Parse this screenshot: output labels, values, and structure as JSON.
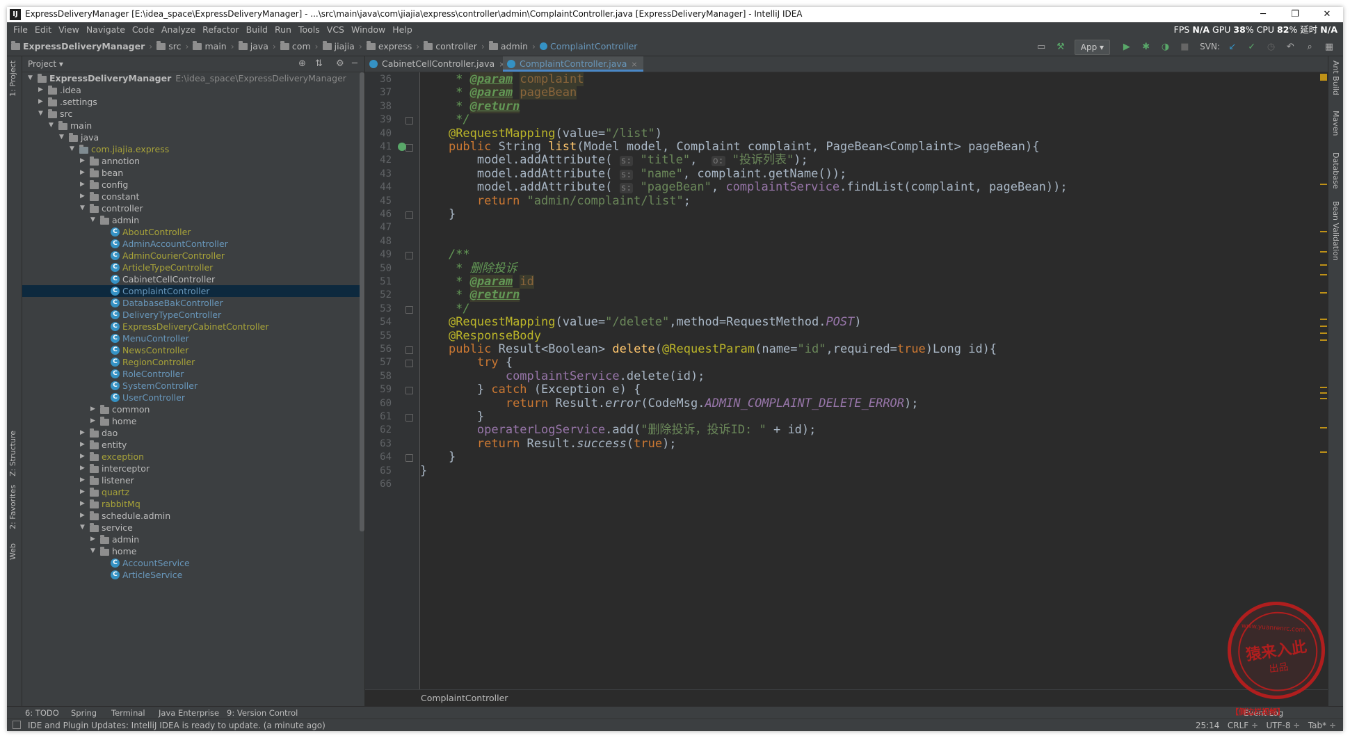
{
  "window": {
    "title": "ExpressDeliveryManager [E:\\idea_space\\ExpressDeliveryManager] - ...\\src\\main\\java\\com\\jiajia\\express\\controller\\admin\\ComplaintController.java [ExpressDeliveryManager] - IntelliJ IDEA",
    "app_icon": "IJ",
    "minimize": "─",
    "restore": "❐",
    "close": "✕"
  },
  "menu": [
    "File",
    "Edit",
    "View",
    "Navigate",
    "Code",
    "Analyze",
    "Refactor",
    "Build",
    "Run",
    "Tools",
    "VCS",
    "Window",
    "Help"
  ],
  "perf": {
    "fps_label": "FPS",
    "fps": "N/A",
    "gpu_label": "GPU",
    "gpu": "38",
    "cpu_label": "% CPU",
    "cpu": "82",
    "delay_label": "% 延时",
    "delay": "N/A"
  },
  "breadcrumbs": [
    "ExpressDeliveryManager",
    "src",
    "main",
    "java",
    "com",
    "jiajia",
    "express",
    "controller",
    "admin",
    "ComplaintController"
  ],
  "toolbar": {
    "run_config": "App ▾",
    "svn_label": "SVN:"
  },
  "left_strip": {
    "project": "1: Project",
    "structure": "Z: Structure",
    "favorites": "2: Favorites",
    "web": "Web"
  },
  "right_strip": [
    "Ant Build",
    "Maven",
    "Database",
    "Bean Validation"
  ],
  "project_panel": {
    "title": "Project ▾",
    "tree": [
      {
        "label": "ExpressDeliveryManager",
        "path": "E:\\idea_space\\ExpressDeliveryManager",
        "depth": 0,
        "kind": "root",
        "arrow": "▼"
      },
      {
        "label": ".idea",
        "depth": 1,
        "kind": "folder",
        "arrow": "▶"
      },
      {
        "label": ".settings",
        "depth": 1,
        "kind": "folder",
        "arrow": "▶"
      },
      {
        "label": "src",
        "depth": 1,
        "kind": "folder",
        "arrow": "▼"
      },
      {
        "label": "main",
        "depth": 2,
        "kind": "folder",
        "arrow": "▼"
      },
      {
        "label": "java",
        "depth": 3,
        "kind": "folder",
        "arrow": "▼"
      },
      {
        "label": "com.jiajia.express",
        "depth": 4,
        "kind": "pkg",
        "arrow": "▼",
        "color": "olive"
      },
      {
        "label": "annotion",
        "depth": 5,
        "kind": "folder",
        "arrow": "▶"
      },
      {
        "label": "bean",
        "depth": 5,
        "kind": "folder",
        "arrow": "▶"
      },
      {
        "label": "config",
        "depth": 5,
        "kind": "folder",
        "arrow": "▶"
      },
      {
        "label": "constant",
        "depth": 5,
        "kind": "folder",
        "arrow": "▶"
      },
      {
        "label": "controller",
        "depth": 5,
        "kind": "folder",
        "arrow": "▼"
      },
      {
        "label": "admin",
        "depth": 6,
        "kind": "folder",
        "arrow": "▼"
      },
      {
        "label": "AboutController",
        "depth": 7,
        "kind": "class",
        "color": "olive"
      },
      {
        "label": "AdminAccountController",
        "depth": 7,
        "kind": "class",
        "color": "blue"
      },
      {
        "label": "AdminCourierController",
        "depth": 7,
        "kind": "class",
        "color": "olive"
      },
      {
        "label": "ArticleTypeController",
        "depth": 7,
        "kind": "class",
        "color": "olive"
      },
      {
        "label": "CabinetCellController",
        "depth": 7,
        "kind": "class"
      },
      {
        "label": "ComplaintController",
        "depth": 7,
        "kind": "class",
        "color": "blue",
        "selected": true
      },
      {
        "label": "DatabaseBakController",
        "depth": 7,
        "kind": "class",
        "color": "blue"
      },
      {
        "label": "DeliveryTypeController",
        "depth": 7,
        "kind": "class",
        "color": "blue"
      },
      {
        "label": "ExpressDeliveryCabinetController",
        "depth": 7,
        "kind": "class",
        "color": "olive"
      },
      {
        "label": "MenuController",
        "depth": 7,
        "kind": "class",
        "color": "blue"
      },
      {
        "label": "NewsController",
        "depth": 7,
        "kind": "class",
        "color": "olive"
      },
      {
        "label": "RegionController",
        "depth": 7,
        "kind": "class",
        "color": "olive"
      },
      {
        "label": "RoleController",
        "depth": 7,
        "kind": "class",
        "color": "blue"
      },
      {
        "label": "SystemController",
        "depth": 7,
        "kind": "class",
        "color": "blue"
      },
      {
        "label": "UserController",
        "depth": 7,
        "kind": "class",
        "color": "blue"
      },
      {
        "label": "common",
        "depth": 6,
        "kind": "folder",
        "arrow": "▶"
      },
      {
        "label": "home",
        "depth": 6,
        "kind": "folder",
        "arrow": "▶"
      },
      {
        "label": "dao",
        "depth": 5,
        "kind": "folder",
        "arrow": "▶"
      },
      {
        "label": "entity",
        "depth": 5,
        "kind": "folder",
        "arrow": "▶"
      },
      {
        "label": "exception",
        "depth": 5,
        "kind": "folder",
        "arrow": "▶",
        "color": "olive"
      },
      {
        "label": "interceptor",
        "depth": 5,
        "kind": "folder",
        "arrow": "▶"
      },
      {
        "label": "listener",
        "depth": 5,
        "kind": "folder",
        "arrow": "▶"
      },
      {
        "label": "quartz",
        "depth": 5,
        "kind": "folder",
        "arrow": "▶",
        "color": "olive"
      },
      {
        "label": "rabbitMq",
        "depth": 5,
        "kind": "folder",
        "arrow": "▶",
        "color": "olive"
      },
      {
        "label": "schedule.admin",
        "depth": 5,
        "kind": "folder",
        "arrow": "▶"
      },
      {
        "label": "service",
        "depth": 5,
        "kind": "folder",
        "arrow": "▼"
      },
      {
        "label": "admin",
        "depth": 6,
        "kind": "folder",
        "arrow": "▶"
      },
      {
        "label": "home",
        "depth": 6,
        "kind": "folder",
        "arrow": "▼"
      },
      {
        "label": "AccountService",
        "depth": 7,
        "kind": "class",
        "color": "blue"
      },
      {
        "label": "ArticleService",
        "depth": 7,
        "kind": "class",
        "color": "blue"
      }
    ]
  },
  "tabs": [
    {
      "label": "CabinetCellController.java",
      "active": false
    },
    {
      "label": "ComplaintController.java",
      "active": true
    }
  ],
  "editor": {
    "first_line": 36,
    "lines": [
      [
        {
          "t": "     * ",
          "c": "cm"
        },
        {
          "t": "@param",
          "c": "jdt"
        },
        {
          "t": " ",
          "c": "cm"
        },
        {
          "t": "complaint",
          "c": "jdp"
        }
      ],
      [
        {
          "t": "     * ",
          "c": "cm"
        },
        {
          "t": "@param",
          "c": "jdt"
        },
        {
          "t": " ",
          "c": "cm"
        },
        {
          "t": "pageBean",
          "c": "jdp"
        }
      ],
      [
        {
          "t": "     * ",
          "c": "cm"
        },
        {
          "t": "@return",
          "c": "jdt"
        }
      ],
      [
        {
          "t": "     */",
          "c": "cm"
        }
      ],
      [
        {
          "t": "    "
        },
        {
          "t": "@RequestMapping",
          "c": "an"
        },
        {
          "t": "(value="
        },
        {
          "t": "\"/list\"",
          "c": "st"
        },
        {
          "t": ")"
        }
      ],
      [
        {
          "t": "    "
        },
        {
          "t": "public",
          "c": "kw"
        },
        {
          "t": " String "
        },
        {
          "t": "list",
          "c": "fn"
        },
        {
          "t": "(Model model, Complaint complaint, PageBean<Complaint> pageBean){"
        }
      ],
      [
        {
          "t": "        model.addAttribute( "
        },
        {
          "t": "s:",
          "c": "hint"
        },
        {
          "t": " "
        },
        {
          "t": "\"title\"",
          "c": "st"
        },
        {
          "t": ",  "
        },
        {
          "t": "o:",
          "c": "hint"
        },
        {
          "t": " "
        },
        {
          "t": "\"投诉列表\"",
          "c": "st"
        },
        {
          "t": ");"
        }
      ],
      [
        {
          "t": "        model.addAttribute( "
        },
        {
          "t": "s:",
          "c": "hint"
        },
        {
          "t": " "
        },
        {
          "t": "\"name\"",
          "c": "st"
        },
        {
          "t": ", complaint.getName());"
        }
      ],
      [
        {
          "t": "        model.addAttribute( "
        },
        {
          "t": "s:",
          "c": "hint"
        },
        {
          "t": " "
        },
        {
          "t": "\"pageBean\"",
          "c": "st"
        },
        {
          "t": ", "
        },
        {
          "t": "complaintService",
          "c": "fld"
        },
        {
          "t": ".findList(complaint, pageBean));"
        }
      ],
      [
        {
          "t": "        "
        },
        {
          "t": "return",
          "c": "kw"
        },
        {
          "t": " "
        },
        {
          "t": "\"admin/complaint/list\"",
          "c": "st"
        },
        {
          "t": ";"
        }
      ],
      [
        {
          "t": "    }"
        }
      ],
      [
        {
          "t": ""
        }
      ],
      [
        {
          "t": ""
        }
      ],
      [
        {
          "t": "    /**",
          "c": "cm"
        }
      ],
      [
        {
          "t": "     * 删除投诉",
          "c": "cm"
        }
      ],
      [
        {
          "t": "     * ",
          "c": "cm"
        },
        {
          "t": "@param",
          "c": "jdt"
        },
        {
          "t": " ",
          "c": "cm"
        },
        {
          "t": "id",
          "c": "jdp"
        }
      ],
      [
        {
          "t": "     * ",
          "c": "cm"
        },
        {
          "t": "@return",
          "c": "jdt"
        }
      ],
      [
        {
          "t": "     */",
          "c": "cm"
        }
      ],
      [
        {
          "t": "    "
        },
        {
          "t": "@RequestMapping",
          "c": "an"
        },
        {
          "t": "(value="
        },
        {
          "t": "\"/delete\"",
          "c": "st"
        },
        {
          "t": ",method=RequestMethod."
        },
        {
          "t": "POST",
          "c": "ifld"
        },
        {
          "t": ")"
        }
      ],
      [
        {
          "t": "    "
        },
        {
          "t": "@ResponseBody",
          "c": "an"
        }
      ],
      [
        {
          "t": "    "
        },
        {
          "t": "public",
          "c": "kw"
        },
        {
          "t": " Result<Boolean> "
        },
        {
          "t": "delete",
          "c": "fn"
        },
        {
          "t": "("
        },
        {
          "t": "@RequestParam",
          "c": "an"
        },
        {
          "t": "(name="
        },
        {
          "t": "\"id\"",
          "c": "st"
        },
        {
          "t": ",required="
        },
        {
          "t": "true",
          "c": "kw"
        },
        {
          "t": ")Long id){"
        }
      ],
      [
        {
          "t": "        "
        },
        {
          "t": "try",
          "c": "kw"
        },
        {
          "t": " {"
        }
      ],
      [
        {
          "t": "            "
        },
        {
          "t": "complaintService",
          "c": "fld"
        },
        {
          "t": ".delete(id);"
        }
      ],
      [
        {
          "t": "        } "
        },
        {
          "t": "catch",
          "c": "kw"
        },
        {
          "t": " (Exception e) {"
        }
      ],
      [
        {
          "t": "            "
        },
        {
          "t": "return",
          "c": "kw"
        },
        {
          "t": " Result."
        },
        {
          "t": "error",
          "c": "ital"
        },
        {
          "t": "(CodeMsg."
        },
        {
          "t": "ADMIN_COMPLAINT_DELETE_ERROR",
          "c": "ifld"
        },
        {
          "t": ");"
        }
      ],
      [
        {
          "t": "        }"
        }
      ],
      [
        {
          "t": "        "
        },
        {
          "t": "operaterLogService",
          "c": "fld"
        },
        {
          "t": ".add("
        },
        {
          "t": "\"删除投诉，投诉ID: \"",
          "c": "st"
        },
        {
          "t": " + id);"
        }
      ],
      [
        {
          "t": "        "
        },
        {
          "t": "return",
          "c": "kw"
        },
        {
          "t": " Result."
        },
        {
          "t": "success",
          "c": "ital"
        },
        {
          "t": "("
        },
        {
          "t": "true",
          "c": "kw"
        },
        {
          "t": ");"
        }
      ],
      [
        {
          "t": "    }"
        }
      ],
      [
        {
          "t": "}"
        }
      ],
      [
        {
          "t": ""
        }
      ]
    ],
    "breadcrumb": "ComplaintController"
  },
  "bottom_tabs": [
    "6: TODO",
    "Spring",
    "Terminal",
    "Java Enterprise",
    "9: Version Control"
  ],
  "event_log": "Event Log",
  "status": {
    "message": "IDE and Plugin Updates: IntelliJ IDEA is ready to update. (a minute ago)",
    "position": "25:14",
    "line_sep": "CRLF ÷",
    "encoding": "UTF-8 ÷",
    "indent": "Tab* ÷"
  },
  "stamp": {
    "url": "www.yuanrenrc.com",
    "big": "猿来入此",
    "small": "出品",
    "note": "【侧边栏视频】"
  }
}
